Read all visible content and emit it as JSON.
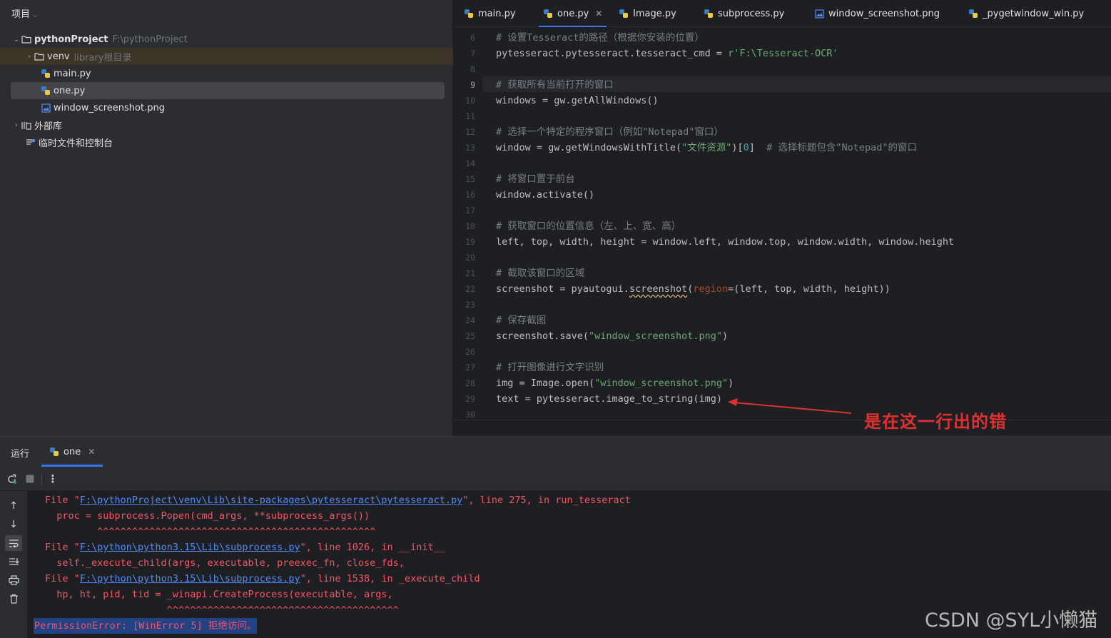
{
  "project": {
    "header": "项目",
    "root": {
      "name": "pythonProject",
      "path": "F:\\pythonProject"
    },
    "venv": {
      "name": "venv",
      "hint": "library根目录"
    },
    "files": [
      "main.py",
      "one.py",
      "window_screenshot.png"
    ],
    "external": "外部库",
    "scratches": "临时文件和控制台"
  },
  "tabs": [
    "main.py",
    "one.py",
    "Image.py",
    "subprocess.py",
    "window_screenshot.png",
    "_pygetwindow_win.py"
  ],
  "editor": {
    "line_numbers": [
      "6",
      "7",
      "8",
      "9",
      "10",
      "11",
      "12",
      "13",
      "14",
      "15",
      "16",
      "17",
      "18",
      "19",
      "20",
      "21",
      "22",
      "23",
      "24",
      "25",
      "26",
      "27",
      "28",
      "29",
      "30"
    ],
    "lines": {
      "l6": "# 设置Tesseract的路径（根据你安装的位置）",
      "l7a": "pytesseract.pytesseract.tesseract_cmd = ",
      "l7b": "r'F:\\Tesseract-OCR'",
      "l9": "# 获取所有当前打开的窗口",
      "l10": "windows = gw.getAllWindows()",
      "l12": "# 选择一个特定的程序窗口（例如\"Notepad\"窗口）",
      "l13a": "window = gw.getWindowsWithTitle(",
      "l13b": "\"文件资源\"",
      "l13c": ")[",
      "l13d": "0",
      "l13e": "]  ",
      "l13f": "# 选择标题包含\"Notepad\"的窗口",
      "l15": "# 将窗口置于前台",
      "l16": "window.activate()",
      "l18": "# 获取窗口的位置信息（左、上、宽、高）",
      "l19": "left, top, width, height = window.left, window.top, window.width, window.height",
      "l21": "# 截取该窗口的区域",
      "l22a": "screenshot = pyautogui.",
      "l22b": "screenshot",
      "l22c": "(",
      "l22d": "region",
      "l22e": "=(left, top, width, height))",
      "l24": "# 保存截图",
      "l25a": "screenshot.save(",
      "l25b": "\"window_screenshot.png\"",
      "l25c": ")",
      "l27": "# 打开图像进行文字识别",
      "l28a": "img = Image.open(",
      "l28b": "\"window_screenshot.png\"",
      "l28c": ")",
      "l29": "text = pytesseract.image_to_string(img)"
    }
  },
  "annotation": "是在这一行出的错",
  "run": {
    "title": "运行",
    "tab": "one"
  },
  "console": {
    "t1a": "File \"",
    "t1b": "F:\\pythonProject\\venv\\Lib\\site-packages\\pytesseract\\pytesseract.py",
    "t1c": "\", line 275, in run_tesseract",
    "t2": "  proc = subprocess.Popen(cmd_args, **subprocess_args())",
    "t3": "         ^^^^^^^^^^^^^^^^^^^^^^^^^^^^^^^^^^^^^^^^^^^^^^^^",
    "t4a": "File \"",
    "t4b": "F:\\python\\python3.15\\Lib\\subprocess.py",
    "t4c": "\", line 1026, in __init__",
    "t5": "  self._execute_child(args, executable, preexec_fn, close_fds,",
    "t6a": "File \"",
    "t6b": "F:\\python\\python3.15\\Lib\\subprocess.py",
    "t6c": "\", line 1538, in _execute_child",
    "t7": "  hp, ht, pid, tid = _winapi.CreateProcess(executable, args,",
    "t8": "                     ^^^^^^^^^^^^^^^^^^^^^^^^^^^^^^^^^^^^^^^^",
    "error": "PermissionError: [WinError 5] 拒绝访问。"
  },
  "watermark": "CSDN @SYL小懒猫",
  "colors": {
    "accent": "#3574f0",
    "error": "#f75464",
    "annotation": "#e03030",
    "string": "#6aab73",
    "comment": "#7a7e85"
  }
}
